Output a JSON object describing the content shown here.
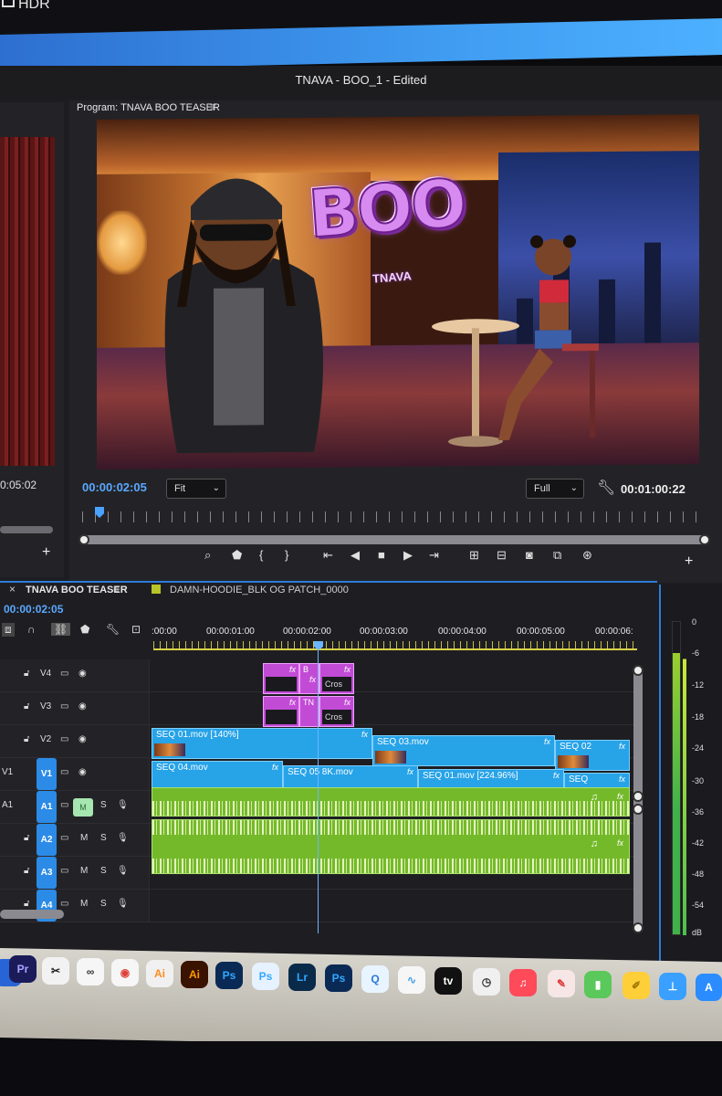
{
  "top": {
    "hdr_label": "HDR"
  },
  "window": {
    "title": "TNAVA - BOO_1 - Edited"
  },
  "source": {
    "timecode": "0:05:02"
  },
  "program": {
    "tab_label": "Program: TNAVA BOO TEASER",
    "menu_icon": "hamburger-icon",
    "overlay_title": "BOO",
    "overlay_subtitle": "TNAVA",
    "timecode_current": "00:00:02:05",
    "fit_select": "Fit",
    "quality_select": "Full",
    "timecode_duration": "00:01:00:22"
  },
  "timeline": {
    "tab_label": "TNAVA BOO TEASER",
    "tab2_label": "DAMN-HOODIE_BLK OG PATCH_0000",
    "timecode": "00:00:02:05",
    "ruler": [
      ":00:00",
      "00:00:01:00",
      "00:00:02:00",
      "00:00:03:00",
      "00:00:04:00",
      "00:00:05:00",
      "00:00:06:"
    ],
    "tracks": {
      "v4": "V4",
      "v3": "V3",
      "v2": "V2",
      "v1_src": "V1",
      "v1": "V1",
      "a1_src": "A1",
      "a1": "A1",
      "a2": "A2",
      "a3": "A3",
      "a4": "A4",
      "mute": "M",
      "solo": "S"
    },
    "gfx": {
      "v4_a_fx": "fx",
      "v4_b_name": "B",
      "v4_b_fx": "fx",
      "v4_c_fx": "fx",
      "v4_c_box": "Cros",
      "v3_a_fx": "fx",
      "v3_b_name": "TN",
      "v3_b_fx": "fx",
      "v3_c_box": "Cros",
      "v3_c_fx": "fx"
    },
    "clips_v2": [
      {
        "name": "SEQ 01.mov [140%]",
        "fx": "fx"
      },
      {
        "name": "SEQ 03.mov",
        "fx": "fx"
      },
      {
        "name": "SEQ 02",
        "fx": "fx"
      }
    ],
    "clips_v1": [
      {
        "name": "SEQ 04.mov",
        "fx": "fx"
      },
      {
        "name": "SEQ 05 8K.mov",
        "fx": "fx"
      },
      {
        "name": "SEQ 01.mov [224.96%]",
        "fx": "fx"
      },
      {
        "name": "SEQ",
        "fx": "fx"
      }
    ],
    "audio_fx": "fx"
  },
  "meter": {
    "labels": [
      "0",
      "-6",
      "-12",
      "-18",
      "-24",
      "-30",
      "-36",
      "-42",
      "-48",
      "-54",
      "dB"
    ]
  },
  "dock": {
    "apps": [
      "Pr",
      "Ai",
      "Ai",
      "Ps",
      "Ps",
      "Lr",
      "Ps",
      "tv"
    ],
    "colors": {
      "pr": "#1b1b5a",
      "ai": "#3a1200",
      "ps": "#0a2a55",
      "lr": "#0a2a4a"
    }
  }
}
